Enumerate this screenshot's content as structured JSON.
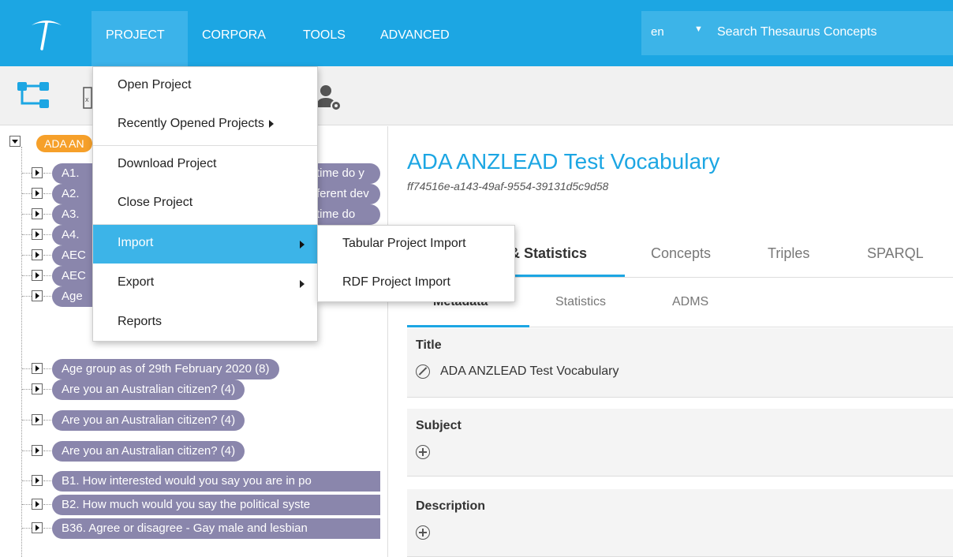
{
  "topbar": {
    "menu": [
      "PROJECT",
      "CORPORA",
      "TOOLS",
      "ADVANCED"
    ],
    "language": "en",
    "search_placeholder": "Search Thesaurus Concepts"
  },
  "colors": {
    "brand": "#1ca6e3",
    "highlight": "#3cb4e8",
    "root_chip": "#f6a02a",
    "concept_chip": "#8a86ac"
  },
  "project_menu": {
    "items": [
      {
        "label": "Open Project"
      },
      {
        "label": "Recently Opened Projects",
        "has_submenu": true
      },
      {
        "label": "Download Project"
      },
      {
        "label": "Close Project"
      },
      {
        "label": "Import",
        "has_submenu": true,
        "highlighted": true
      },
      {
        "label": "Export",
        "has_submenu": true
      },
      {
        "label": "Reports"
      }
    ],
    "import_submenu": [
      "Tabular Project Import",
      "RDF Project Import"
    ]
  },
  "tree": {
    "root": "ADA AN",
    "nodes": [
      {
        "label": "A1.",
        "tail": "time do y"
      },
      {
        "label": "A2.",
        "tail": "ferent dev"
      },
      {
        "label": "A3.",
        "tail": "time do"
      },
      {
        "label": "A4.",
        "tail": ""
      },
      {
        "label": "AEC",
        "tail": ""
      },
      {
        "label": "AEC",
        "tail": ""
      },
      {
        "label": "Age",
        "tail": ""
      },
      {
        "label": "Age group as of 29th February 2020 (8)"
      },
      {
        "label": "Are you an Australian citizen? (4)"
      },
      {
        "label": "Are you an Australian citizen? (4)"
      },
      {
        "label": "Are you an Australian citizen? (4)"
      },
      {
        "label": "B1. How interested would you say you are in po"
      },
      {
        "label": "B2. How much would you say the political syste"
      },
      {
        "label": "B36. Agree or disagree - Gay male and lesbian"
      }
    ]
  },
  "project": {
    "title": "ADA ANZLEAD Test Vocabulary",
    "id": "ff74516e-a143-49af-9554-39131d5c9d58"
  },
  "tabs": [
    "& Statistics",
    "Concepts",
    "Triples",
    "SPARQL"
  ],
  "subtabs": [
    "Metadata",
    "Statistics",
    "ADMS"
  ],
  "properties": [
    {
      "label": "Title",
      "value": "ADA ANZLEAD Test Vocabulary"
    },
    {
      "label": "Subject"
    },
    {
      "label": "Description"
    }
  ]
}
